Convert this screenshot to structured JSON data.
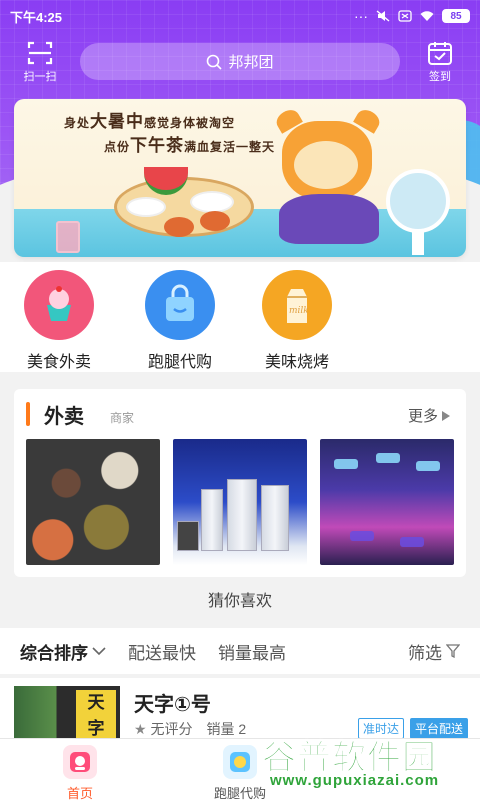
{
  "status_bar": {
    "time": "下午4:25",
    "battery": "85"
  },
  "header": {
    "scan_label": "扫一扫",
    "search_placeholder": "邦邦团",
    "signin_label": "签到"
  },
  "banner": {
    "line1_pre": "身处",
    "line1_big": "大暑中",
    "line1_post": "感觉身体被淘空",
    "line2_pre": "点份",
    "line2_big": "下午茶",
    "line2_post": "满血复活一整天"
  },
  "categories": [
    {
      "label": "美食外卖",
      "icon": "cupcake-icon",
      "color": "#f2567a"
    },
    {
      "label": "跑腿代购",
      "icon": "shopping-bag-icon",
      "color": "#3a8ff0"
    },
    {
      "label": "美味烧烤",
      "icon": "milk-carton-icon",
      "color": "#f5a623"
    }
  ],
  "section": {
    "title": "外卖",
    "subtitle": "商家",
    "more": "更多"
  },
  "guess_title": "猜你喜欢",
  "sort": {
    "active": "综合排序",
    "options": [
      "配送最快",
      "销量最高"
    ],
    "filter": "筛选"
  },
  "shop": {
    "name": "天字①号",
    "sign_text": [
      "天",
      "字"
    ],
    "rating": "无评分",
    "sales": "销量 2",
    "tags": [
      "准时达",
      "平台配送"
    ]
  },
  "tabs": [
    {
      "label": "首页",
      "active": true
    },
    {
      "label": "跑腿代购",
      "active": false
    }
  ],
  "watermark": {
    "logo": "谷普软件园",
    "url": "www.gupuxiazai.com"
  },
  "colors": {
    "header_purple": "#8a3df3",
    "accent_orange": "#ff7a1a",
    "active_tab": "#ff5a2a"
  }
}
